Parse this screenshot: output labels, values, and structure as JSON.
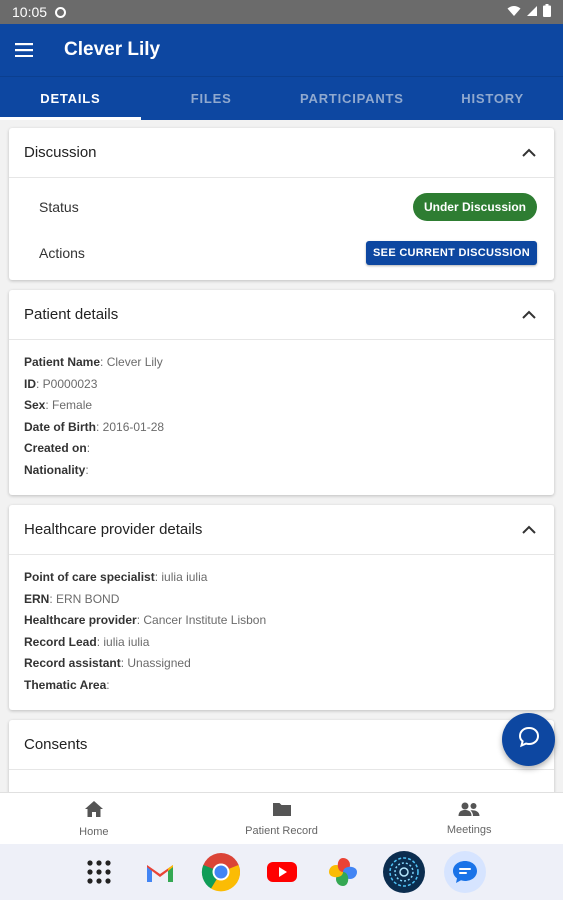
{
  "status_bar": {
    "time": "10:05"
  },
  "app_bar": {
    "title": "Clever Lily",
    "menu_icon": "hamburger-icon"
  },
  "tabs": [
    {
      "label": "DETAILS",
      "active": true
    },
    {
      "label": "FILES",
      "active": false
    },
    {
      "label": "PARTICIPANTS",
      "active": false
    },
    {
      "label": "HISTORY",
      "active": false
    }
  ],
  "discussion": {
    "title": "Discussion",
    "status_label": "Status",
    "status_value": "Under Discussion",
    "actions_label": "Actions",
    "action_button": "SEE CURRENT DISCUSSION"
  },
  "patient": {
    "title": "Patient details",
    "fields": [
      {
        "label": "Patient Name",
        "sep": ": ",
        "value": "Clever Lily"
      },
      {
        "label": "ID",
        "sep": ": ",
        "value": "P0000023"
      },
      {
        "label": "Sex",
        "sep": ": ",
        "value": "Female"
      },
      {
        "label": "Date of Birth",
        "sep": ": ",
        "value": "2016-01-28"
      },
      {
        "label": "Created on",
        "sep": ":",
        "value": ""
      },
      {
        "label": "Nationality",
        "sep": ":",
        "value": ""
      }
    ]
  },
  "provider": {
    "title": "Healthcare provider details",
    "fields": [
      {
        "label": "Point of care specialist",
        "sep": ": ",
        "value": "iulia iulia"
      },
      {
        "label": "ERN",
        "sep": ": ",
        "value": "ERN BOND"
      },
      {
        "label": "Healthcare provider",
        "sep": ": ",
        "value": "Cancer Institute Lisbon"
      },
      {
        "label": "Record Lead",
        "sep": ": ",
        "value": "iulia iulia"
      },
      {
        "label": "Record assistant",
        "sep": ": ",
        "value": "Unassigned"
      },
      {
        "label": "Thematic Area",
        "sep": ":",
        "value": ""
      }
    ]
  },
  "consents": {
    "title": "Consents"
  },
  "bottom_nav": [
    {
      "label": "Home",
      "icon": "home-icon"
    },
    {
      "label": "Patient Record",
      "icon": "folder-icon"
    },
    {
      "label": "Meetings",
      "icon": "people-icon"
    }
  ],
  "colors": {
    "primary": "#0d47a1",
    "status_green": "#2e7d32"
  }
}
